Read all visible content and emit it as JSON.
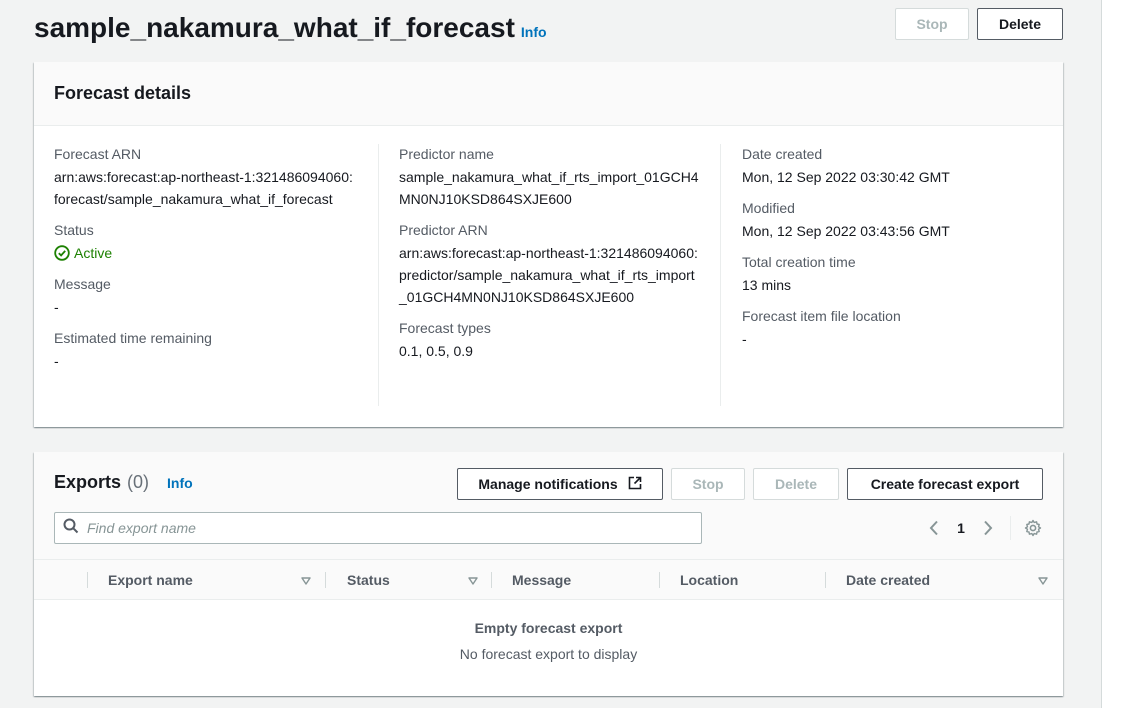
{
  "page": {
    "title": "sample_nakamura_what_if_forecast",
    "info_label": "Info",
    "stop_label": "Stop",
    "delete_label": "Delete"
  },
  "details": {
    "title": "Forecast details",
    "forecast_arn_label": "Forecast ARN",
    "forecast_arn_value": "arn:aws:forecast:ap-northeast-1:321486094060:forecast/sample_nakamura_what_if_forecast",
    "status_label": "Status",
    "status_value": "Active",
    "message_label": "Message",
    "message_value": "-",
    "eta_label": "Estimated time remaining",
    "eta_value": "-",
    "predictor_name_label": "Predictor name",
    "predictor_name_value": "sample_nakamura_what_if_rts_import_01GCH4MN0NJ10KSD864SXJE600",
    "predictor_arn_label": "Predictor ARN",
    "predictor_arn_value": "arn:aws:forecast:ap-northeast-1:321486094060:predictor/sample_nakamura_what_if_rts_import_01GCH4MN0NJ10KSD864SXJE600",
    "forecast_types_label": "Forecast types",
    "forecast_types_value": "0.1, 0.5, 0.9",
    "date_created_label": "Date created",
    "date_created_value": "Mon, 12 Sep 2022 03:30:42 GMT",
    "modified_label": "Modified",
    "modified_value": "Mon, 12 Sep 2022 03:43:56 GMT",
    "total_time_label": "Total creation time",
    "total_time_value": "13 mins",
    "item_file_label": "Forecast item file location",
    "item_file_value": "-"
  },
  "exports": {
    "title": "Exports",
    "count": "(0)",
    "info_label": "Info",
    "manage_notifications_label": "Manage notifications",
    "stop_label": "Stop",
    "delete_label": "Delete",
    "create_label": "Create forecast export",
    "search_placeholder": "Find export name",
    "page_number": "1",
    "columns": {
      "export_name": "Export name",
      "status": "Status",
      "message": "Message",
      "location": "Location",
      "date_created": "Date created"
    },
    "empty_title": "Empty forecast export",
    "empty_subtitle": "No forecast export to display"
  },
  "colors": {
    "link": "#0073bb",
    "success": "#1d8102",
    "disabled": "#aab7b8"
  }
}
